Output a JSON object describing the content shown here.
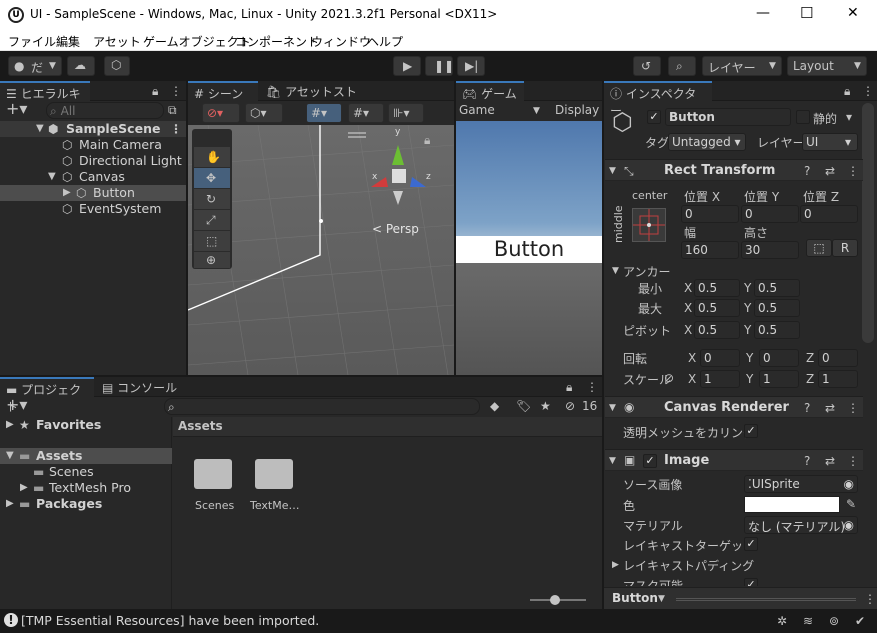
{
  "window": {
    "title": "UI - SampleScene - Windows, Mac, Linux - Unity 2021.3.2f1 Personal <DX11>",
    "minimize": "—",
    "maximize": "☐",
    "close": "✕"
  },
  "menu": [
    "ファイル",
    "編集",
    "アセット",
    "ゲームオブジェクト",
    "コンポーネント",
    "ウィンドウ",
    "ヘルプ"
  ],
  "toolbar": {
    "account_label": "だ",
    "layers_label": "レイヤー",
    "layout_label": "Layout"
  },
  "hierarchy": {
    "tab": "ヒエラルキー",
    "search_placeholder": "All",
    "items": [
      {
        "label": "SampleScene"
      },
      {
        "label": "Main Camera"
      },
      {
        "label": "Directional Light"
      },
      {
        "label": "Canvas"
      },
      {
        "label": "Button"
      },
      {
        "label": "EventSystem"
      }
    ]
  },
  "scene": {
    "tab": "シーン",
    "asset_store_tab": "アセットストア",
    "persp_label": "< Persp",
    "gizmo_y": "y",
    "gizmo_x": "x",
    "gizmo_z": "z"
  },
  "game": {
    "tab": "ゲーム",
    "display_dropdown": "Game",
    "display_label": "Display",
    "button_text": "Button"
  },
  "project": {
    "tab": "プロジェクト",
    "console_tab": "コンソール",
    "favorites": "Favorites",
    "tree": [
      "Assets",
      "Scenes",
      "TextMesh Pro",
      "Packages"
    ],
    "breadcrumb": "Assets",
    "count": "16",
    "assets": [
      "Scenes",
      "TextMe…"
    ]
  },
  "inspector": {
    "tab": "インスペクター",
    "object_name": "Button",
    "static_label": "静的",
    "tag_label": "タグ",
    "tag_value": "Untagged",
    "layer_label": "レイヤー",
    "layer_value": "UI",
    "rect_transform": {
      "title": "Rect Transform",
      "anchor_h": "center",
      "anchor_v": "middle",
      "pos_x_label": "位置 X",
      "pos_y_label": "位置 Y",
      "pos_z_label": "位置 Z",
      "pos_x": "0",
      "pos_y": "0",
      "pos_z": "0",
      "width_label": "幅",
      "height_label": "高さ",
      "width": "160",
      "height": "30",
      "r_label": "R",
      "anchors_label": "アンカー",
      "min_label": "最小",
      "min_x": "0.5",
      "min_y": "0.5",
      "max_label": "最大",
      "max_x": "0.5",
      "max_y": "0.5",
      "pivot_label": "ピボット",
      "pivot_x": "0.5",
      "pivot_y": "0.5",
      "rotation_label": "回転",
      "rot_x": "0",
      "rot_y": "0",
      "rot_z": "0",
      "scale_label": "スケール",
      "scale_x": "1",
      "scale_y": "1",
      "scale_z": "1",
      "x": "X",
      "y": "Y",
      "z": "Z"
    },
    "canvas_renderer": {
      "title": "Canvas Renderer",
      "cull_label": "透明メッシュをカリング"
    },
    "image": {
      "title": "Image",
      "source_label": "ソース画像",
      "source_value": "UISprite",
      "color_label": "色",
      "material_label": "マテリアル",
      "material_value": "なし (マテリアル)",
      "raycast_label": "レイキャストターゲット",
      "padding_label": "レイキャストパディング",
      "maskable_label": "マスク可能"
    },
    "footer_label": "Button"
  },
  "status": {
    "message": "[TMP Essential Resources] have been imported."
  }
}
